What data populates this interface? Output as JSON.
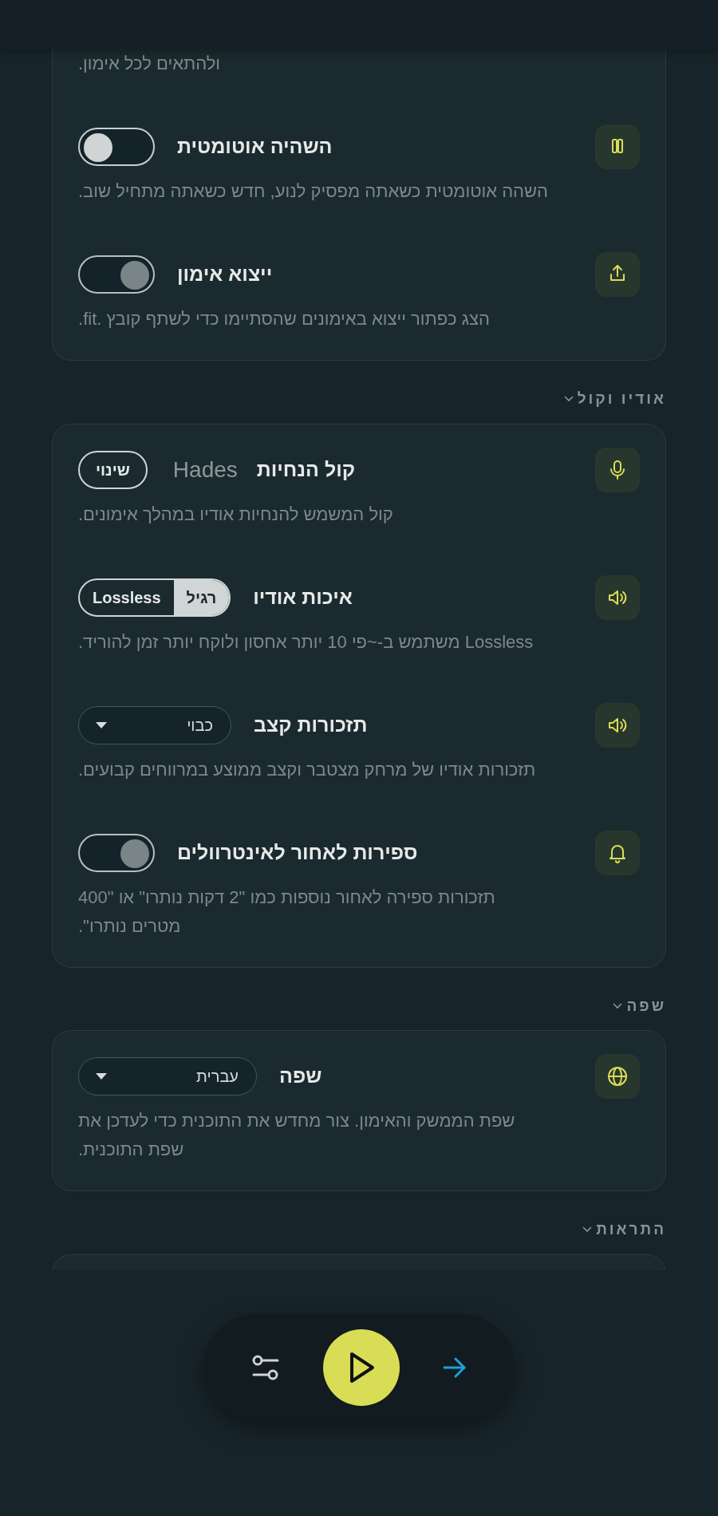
{
  "sections": [
    {
      "rows": [
        {
          "kind": "tail",
          "description": "ולהתאים לכל אימון."
        },
        {
          "kind": "toggle",
          "title": "השהיה אוטומטית",
          "on": true,
          "description": "השהה אוטומטית כשאתה מפסיק לנוע, חדש כשאתה מתחיל שוב."
        },
        {
          "kind": "toggle",
          "title": "ייצוא אימון",
          "on": false,
          "description": "הצג כפתור ייצוא באימונים שהסתיימו כדי לשתף קובץ .fit."
        }
      ]
    },
    {
      "title": "אודיו וקול",
      "rows": [
        {
          "kind": "voice",
          "title": "קול הנחיות",
          "value": "Hades",
          "button": "שינוי",
          "description": "קול המשמש להנחיות אודיו במהלך אימונים."
        },
        {
          "kind": "segmented",
          "title": "איכות אודיו",
          "options": [
            {
              "label": "רגיל",
              "selected": true
            },
            {
              "label": "Lossless",
              "selected": false
            }
          ],
          "description": "Lossless משתמש ב-~פי 10 יותר אחסון ולוקח יותר זמן להוריד."
        },
        {
          "kind": "select",
          "title": "תזכורות קצב",
          "value": "כבוי",
          "description": "תזכורות אודיו של מרחק מצטבר וקצב ממוצע במרווחים קבועים."
        },
        {
          "kind": "toggle",
          "title": "ספירות לאחור לאינטרוולים",
          "on": false,
          "description": "תזכורות ספירה לאחור נוספות כמו \"2 דקות נותרו\" או \"400 מטרים נותרו\"."
        }
      ]
    },
    {
      "title": "שפה",
      "rows": [
        {
          "kind": "select",
          "title": "שפה",
          "value": "עברית",
          "description": "שפת הממשק והאימון. צור מחדש את התוכנית כדי לעדכן את שפת התוכנית."
        }
      ]
    },
    {
      "title": "התראות"
    }
  ]
}
